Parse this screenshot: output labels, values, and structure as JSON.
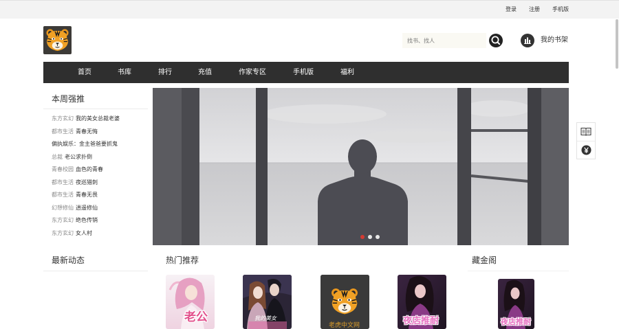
{
  "topbar": {
    "links": [
      {
        "label": "登录"
      },
      {
        "label": "注册"
      },
      {
        "label": "手机版"
      }
    ]
  },
  "header": {
    "logo_icon": "tiger-logo-icon",
    "search": {
      "placeholder": "找书、找人",
      "icon": "search-icon"
    },
    "bookshelf": {
      "icon": "bookshelf-chart-icon",
      "label": "我的书架"
    }
  },
  "nav": {
    "items": [
      "首页",
      "书库",
      "排行",
      "充值",
      "作家专区",
      "手机版",
      "福利"
    ]
  },
  "weekly": {
    "title": "本周强推",
    "items": [
      {
        "category": "东方玄幻",
        "title": "我的美女总裁老婆"
      },
      {
        "category": "都市生活",
        "title": "青春无悔"
      },
      {
        "title": "偏执娱乐：金主爸爸要抓鬼"
      },
      {
        "category": "总裁",
        "title": "老公求扑倒"
      },
      {
        "category": "青春校园",
        "title": "血色的青春"
      },
      {
        "category": "都市生活",
        "title": "夜巡猎刺"
      },
      {
        "category": "都市生活",
        "title": "青春无畏"
      },
      {
        "category": "幻想修仙",
        "title": "逍遥修仙"
      },
      {
        "category": "东方玄幻",
        "title": "绝色传销"
      },
      {
        "category": "东方玄幻",
        "title": "女人村"
      }
    ]
  },
  "banner": {
    "slide_count": 3,
    "active_index": 0
  },
  "side_tools": {
    "items": [
      {
        "icon": "book-icon"
      },
      {
        "icon": "yen-icon"
      }
    ]
  },
  "latest": {
    "title": "最新动态"
  },
  "hot": {
    "title": "热门推荐",
    "books": [
      {
        "cover_text": "老公"
      },
      {
        "cover_text": "我的美女"
      },
      {
        "cover_text": "老虎中文网"
      },
      {
        "cover_text": "夜店推耐"
      }
    ]
  },
  "vault": {
    "title": "藏金阁",
    "books": [
      {
        "cover_text": "夜店推耐"
      }
    ]
  },
  "colors": {
    "nav_background": "#2f2f2f",
    "active_dot": "#d43a32",
    "category_text": "#8a8a8a"
  }
}
